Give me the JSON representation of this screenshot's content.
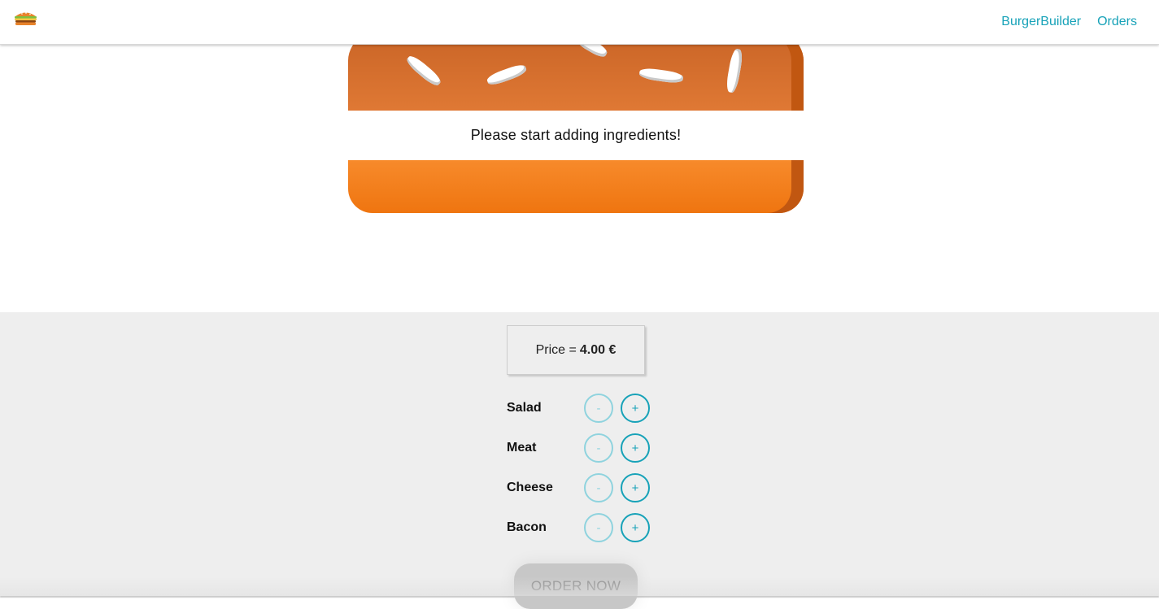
{
  "toolbar": {
    "logo_icon": "burger-logo-icon",
    "nav": [
      {
        "label": "BurgerBuilder"
      },
      {
        "label": "Orders"
      }
    ]
  },
  "burger": {
    "message": "Please start adding ingredients!"
  },
  "controls": {
    "price_label": "Price =",
    "price_value": "4.00 €",
    "ingredients": [
      {
        "label": "Salad",
        "less": "-",
        "more": "+"
      },
      {
        "label": "Meat",
        "less": "-",
        "more": "+"
      },
      {
        "label": "Cheese",
        "less": "-",
        "more": "+"
      },
      {
        "label": "Bacon",
        "less": "-",
        "more": "+"
      }
    ],
    "order_button": "ORDER NOW"
  },
  "colors": {
    "accent": "#17a2b8",
    "bread": "#ef7510",
    "panel": "#eeeeee"
  }
}
